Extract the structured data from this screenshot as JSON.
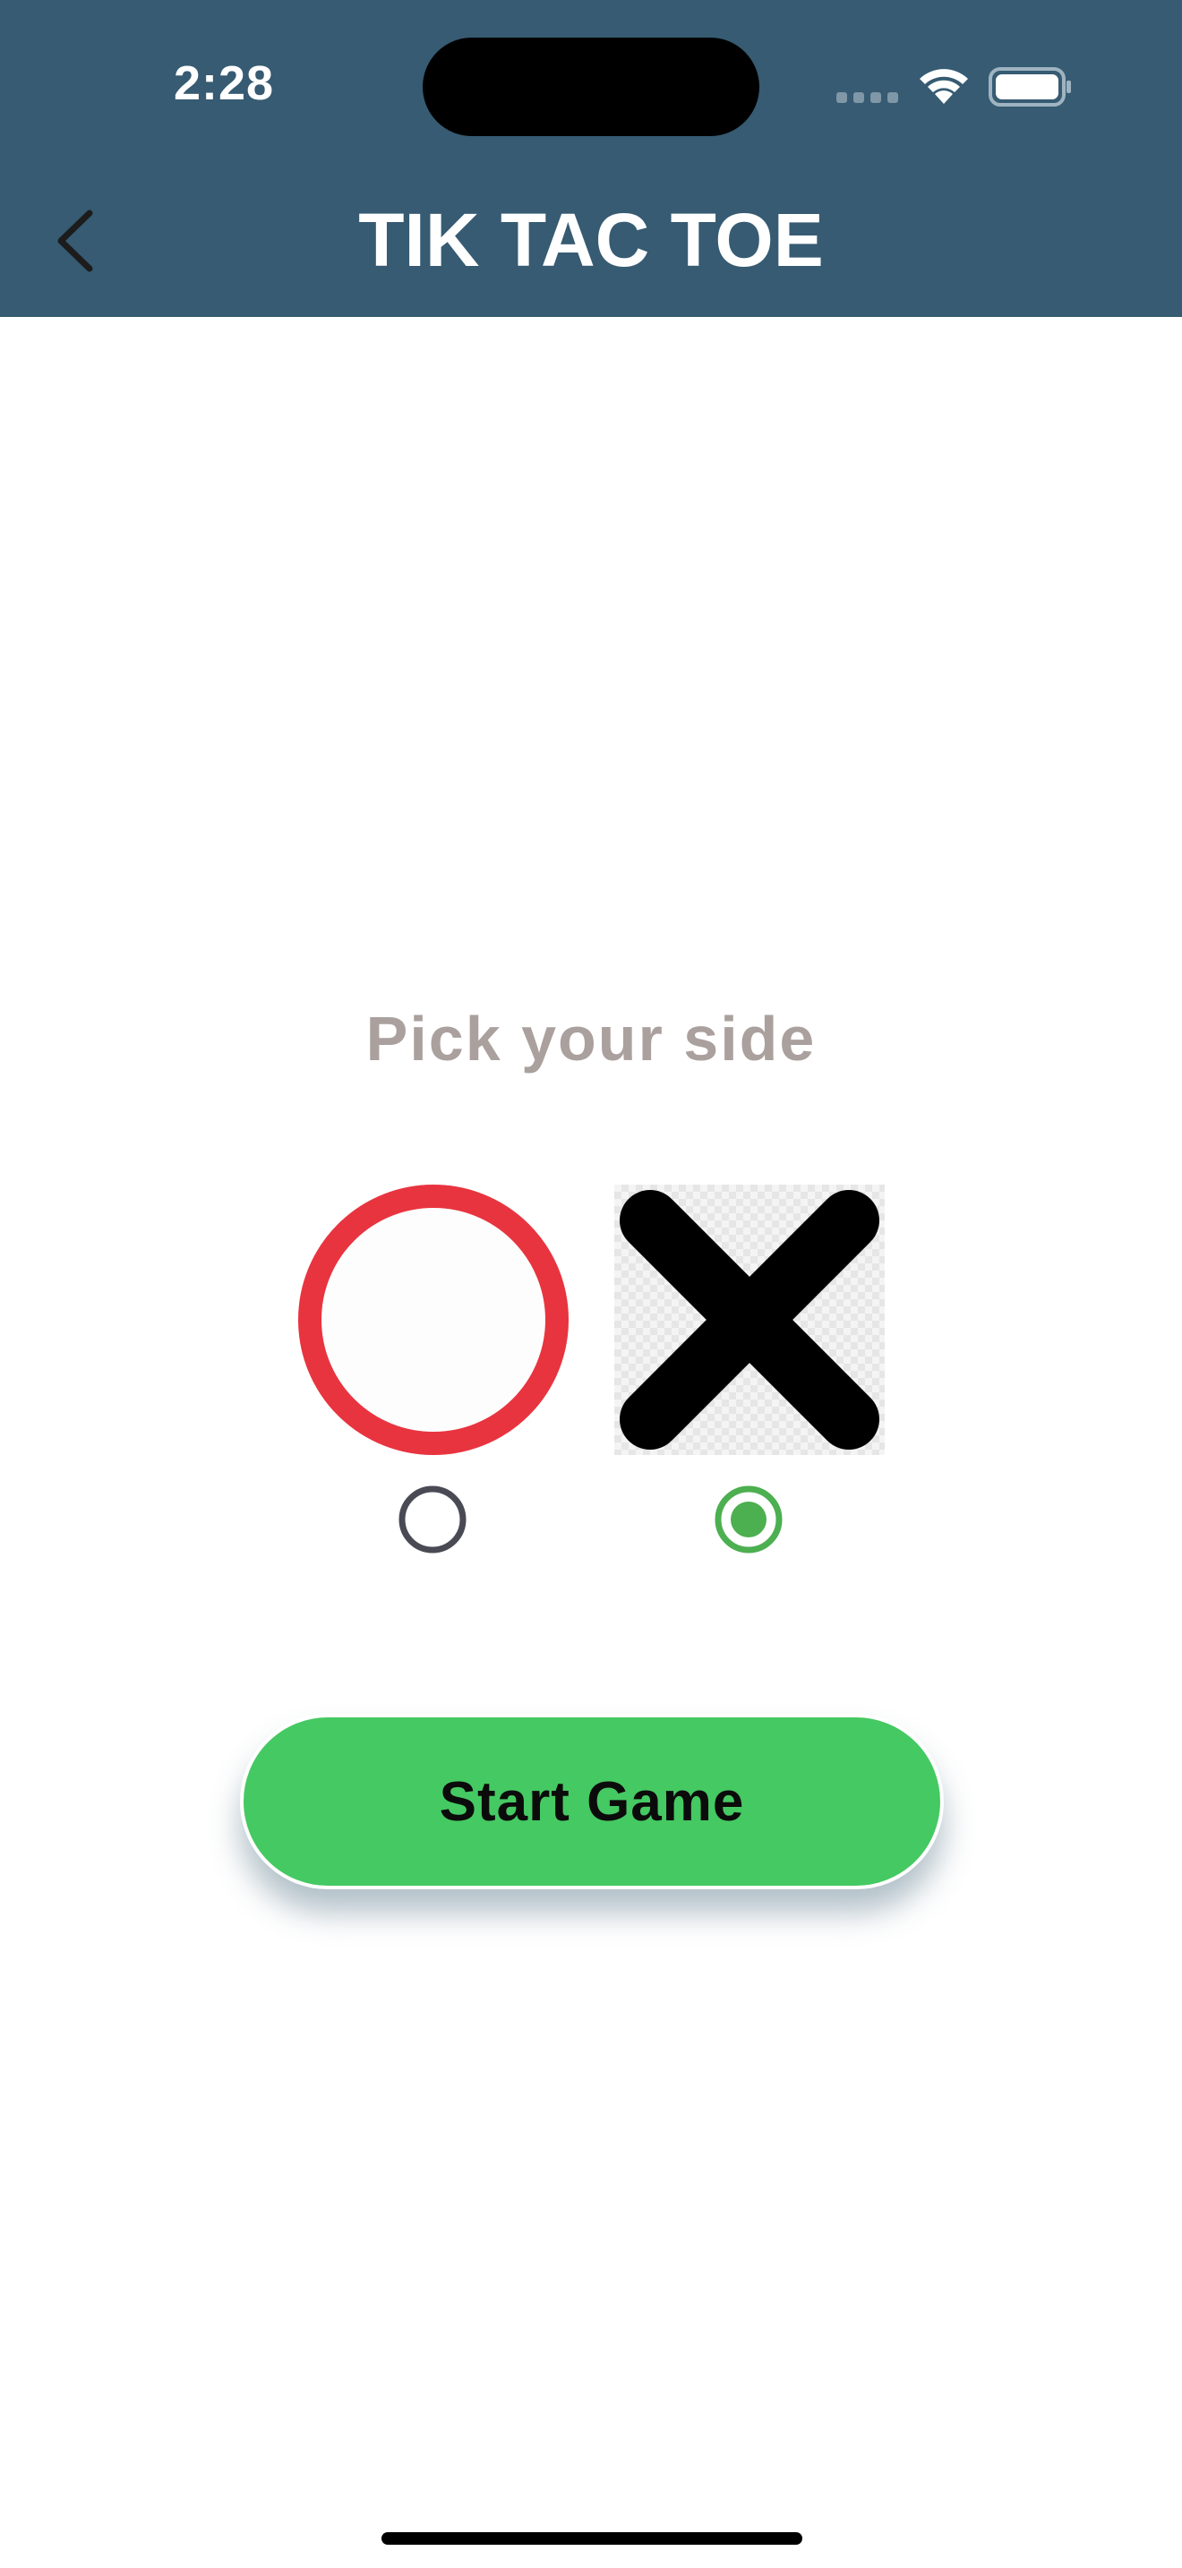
{
  "status_bar": {
    "time": "2:28"
  },
  "nav": {
    "title": "TIK TAC TOE",
    "back_icon": "chevron-left-icon"
  },
  "main": {
    "prompt": "Pick your side",
    "options": [
      {
        "symbol": "O",
        "icon": "circle-o-icon",
        "color": "#e8343f",
        "selected": false
      },
      {
        "symbol": "X",
        "icon": "cross-x-icon",
        "color": "#000000",
        "selected": true
      }
    ],
    "start_button_label": "Start Game"
  },
  "colors": {
    "header": "#365b72",
    "accent_green": "#45c962",
    "radio_selected": "#4caf50",
    "radio_unselected": "#4a4a55",
    "prompt_text": "#aaa09d"
  }
}
